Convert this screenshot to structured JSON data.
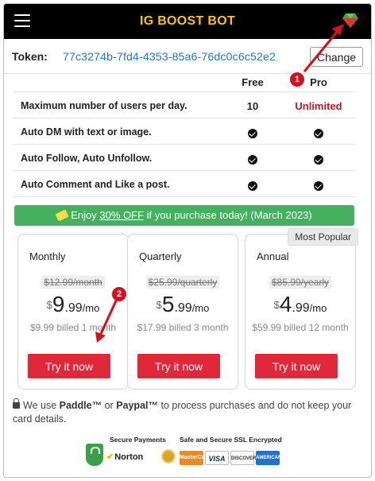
{
  "header": {
    "menu_icon": "hamburger-menu-icon",
    "title": "IG BOOST BOT",
    "logo_icon": "gem-icon"
  },
  "token": {
    "label": "Token:",
    "value": "77c3274b-7fd4-4353-85a6-76dc0c6c52e2",
    "change_label": "Change"
  },
  "comparison": {
    "columns": {
      "free": "Free",
      "pro": "Pro"
    },
    "rows": [
      {
        "label": "Maximum number of users per day.",
        "free": "10",
        "pro": "Unlimited"
      },
      {
        "label": "Auto DM with text or image.",
        "free": "check",
        "pro": "check"
      },
      {
        "label": "Auto Follow, Auto Unfollow.",
        "free": "check",
        "pro": "check"
      },
      {
        "label": "Auto Comment and Like a post.",
        "free": "check",
        "pro": "check"
      }
    ]
  },
  "promo": {
    "icon": "tag-icon",
    "prefix": "Enjoy ",
    "discount": "30% OFF",
    "suffix": " if you purchase today!  (March 2023)"
  },
  "plans": [
    {
      "name": "Monthly",
      "old_price": "$12.99/month",
      "currency": "$",
      "int": "9",
      "dec": ".99",
      "per": "/mo",
      "billed": "$9.99 billed 1 month",
      "cta": "Try it now",
      "badge": ""
    },
    {
      "name": "Quarterly",
      "old_price": "$25.99/quarterly",
      "currency": "$",
      "int": "5",
      "dec": ".99",
      "per": "/mo",
      "billed": "$17.99 billed 3 month",
      "cta": "Try it now",
      "badge": ""
    },
    {
      "name": "Annual",
      "old_price": "$85.99/yearly",
      "currency": "$",
      "int": "4",
      "dec": ".99",
      "per": "/mo",
      "billed": "$59.99 billed 12 month",
      "cta": "Try it now",
      "badge": "Most Popular"
    }
  ],
  "disclaimer": {
    "icon": "lock-icon",
    "pre": "We use ",
    "paddle": "Paddle™",
    "mid": " or ",
    "paypal": "Paypal™",
    "post": " to process purchases and do not keep your card details."
  },
  "security": {
    "secure_payments": "Secure Payments",
    "ssl": "Safe and Secure SSL Encrypted",
    "norton": "Norton",
    "cards": [
      "MasterCard",
      "VISA",
      "DISCOVER",
      "AMERICAN EXPRESS"
    ]
  },
  "annotations": [
    {
      "number": "1"
    },
    {
      "number": "2"
    }
  ],
  "colors": {
    "accent_yellow": "#f5c518",
    "token_blue": "#1a73e8",
    "unlimited_red": "#c0181f",
    "promo_green": "#45b05e",
    "cta_red": "#e0283a",
    "annotation_red": "#d40f1e"
  }
}
